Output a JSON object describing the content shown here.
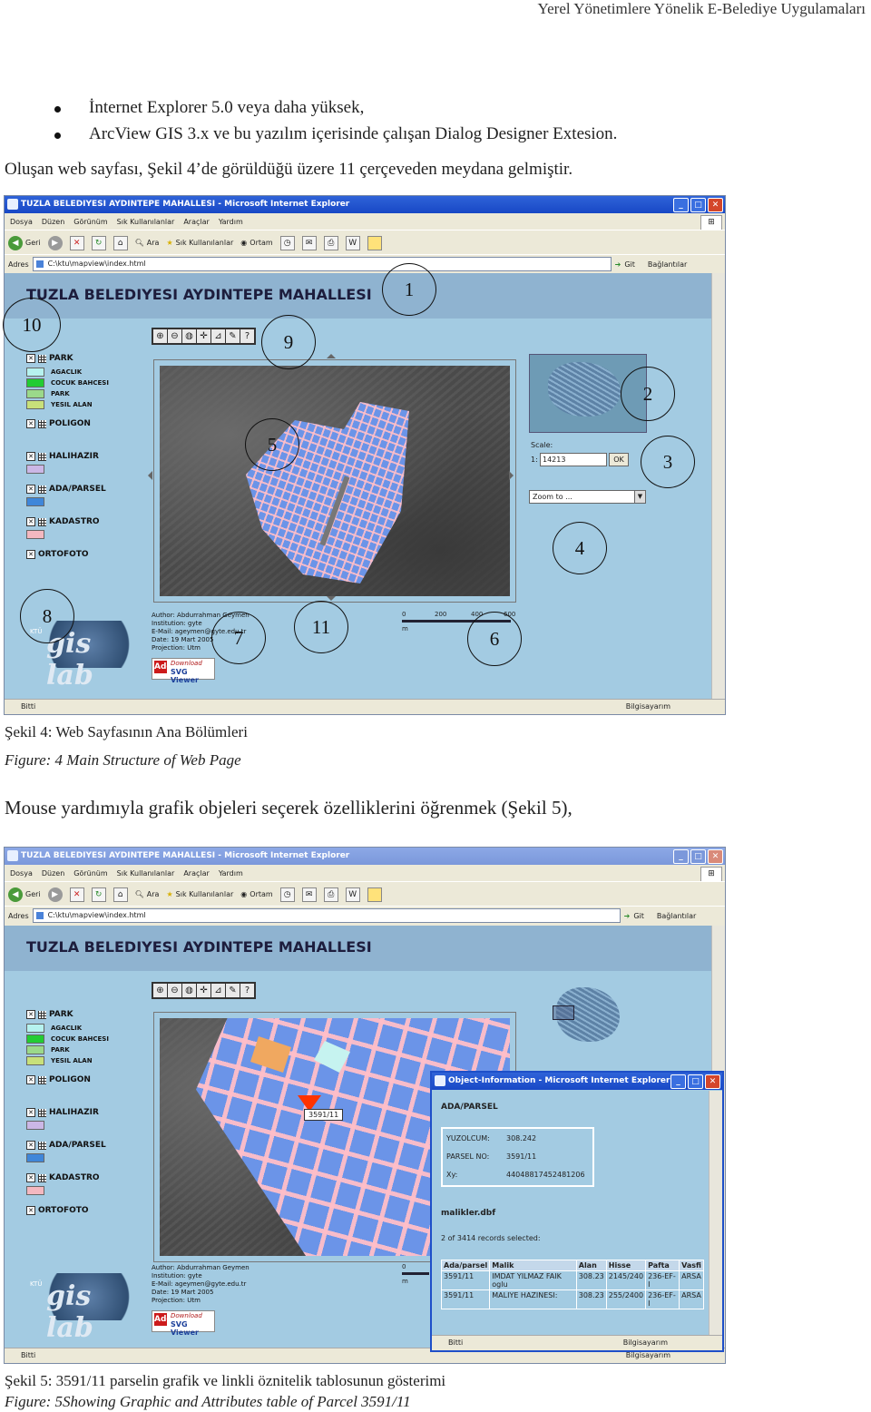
{
  "header": {
    "running_title": "Yerel Yönetimlere Yönelik E-Belediye Uygulamaları"
  },
  "bullets": [
    "İnternet Explorer 5.0 veya daha yüksek,",
    "ArcView GIS 3.x ve bu yazılım içerisinde çalışan Dialog Designer Extesion."
  ],
  "intro_sentence": "Oluşan web sayfası, Şekil 4’de görüldüğü üzere 11 çerçeveden meydana gelmiştir.",
  "figure4": {
    "window_title": "TUZLA BELEDIYESI AYDINTEPE MAHALLESI - Microsoft Internet Explorer",
    "menu": [
      "Dosya",
      "Düzen",
      "Görünüm",
      "Sık Kullanılanlar",
      "Araçlar",
      "Yardım"
    ],
    "toolbar": {
      "back": "Geri",
      "search": "Ara",
      "favorites": "Sık Kullanılanlar",
      "media": "Ortam"
    },
    "address_label": "Adres",
    "address_value": "C:\\ktu\\mapview\\index.html",
    "go_label": "Git",
    "links_label": "Bağlantılar",
    "banner_title": "TUZLA BELEDIYESI AYDINTEPE MAHALLESI",
    "scale_label": "Scale:",
    "scale_prefix": "1:",
    "scale_value": "14213",
    "ok_label": "OK",
    "zoom_label": "Zoom to ...",
    "status_left": "Bitti",
    "status_right": "Bilgisayarım",
    "frame_numbers": [
      "1",
      "2",
      "3",
      "4",
      "5",
      "6",
      "7",
      "8",
      "9",
      "10",
      "11"
    ],
    "caption_tr": "Şekil 4: Web Sayfasının Ana Bölümleri",
    "caption_en": "Figure: 4 Main Structure of Web Page"
  },
  "legend": {
    "park": "PARK",
    "park_items": [
      "AGACLIK",
      "COCUK BAHCESI",
      "PARK",
      "YESIL ALAN"
    ],
    "poligon": "POLIGON",
    "halihazir": "HALIHAZIR",
    "adaparsel": "ADA/PARSEL",
    "kadastro": "KADASTRO",
    "ortofoto": "ORTOFOTO",
    "colors": {
      "agaclik": "#b6f2ef",
      "cocuk": "#22cc33",
      "park": "#9bd98a",
      "yesil": "#c8e07a",
      "halihazir": "#cbb7e6",
      "adaparsel": "#3f86d9",
      "kadastro": "#f4b8c0"
    }
  },
  "map_meta": {
    "author": "Author: Abdurrahman Geymen",
    "institution": "Institution: gyte",
    "email": "E-Mail: ageymen@gyte.edu.tr",
    "date": "Date: 19 Mart 2005",
    "projection": "Projection: Utm",
    "download": "Download",
    "svgviewer": "SVG Viewer",
    "adobe": "Adobe",
    "scale_ticks": [
      "0",
      "200",
      "400",
      "600"
    ],
    "scale_unit": "m",
    "logo_small": "KTÜ",
    "logo_text": "gis lab"
  },
  "para2": "Mouse yardımıyla grafik objeleri seçerek özelliklerini öğrenmek (Şekil 5),",
  "figure5": {
    "window_title": "TUZLA BELEDIYESI AYDINTEPE MAHALLESI - Microsoft Internet Explorer",
    "parcel_label": "3591/11",
    "popup_title": "Object-Information - Microsoft Internet Explorer",
    "popup_layer": "ADA/PARSEL",
    "attrs": [
      {
        "k": "YUZOLCUM:",
        "v": "308.242"
      },
      {
        "k": "PARSEL NO:",
        "v": "3591/11"
      },
      {
        "k": "Xy:",
        "v": "44048817452481206"
      }
    ],
    "table_name": "malikler.dbf",
    "records_selected": "2 of 3414 records selected:",
    "table_headers": [
      "Ada/parsel",
      "Malik",
      "Alan",
      "Hisse",
      "Pafta",
      "Vasfi"
    ],
    "table_rows": [
      [
        "3591/11",
        "IMDAT YILMAZ FAIK oglu",
        "308.23",
        "2145/240",
        "236-EF-I",
        "ARSA"
      ],
      [
        "3591/11",
        "MALIYE HAZINESI:",
        "308.23",
        "255/2400",
        "236-EF-I",
        "ARSA"
      ]
    ],
    "popup_status_left": "Bitti",
    "popup_status_right": "Bilgisayarım",
    "caption_tr": "Şekil 5: 3591/11 parselin grafik ve linkli öznitelik tablosunun gösterimi",
    "caption_en": "Figure: 5Showing Graphic and Attributes table of Parcel 3591/11"
  }
}
